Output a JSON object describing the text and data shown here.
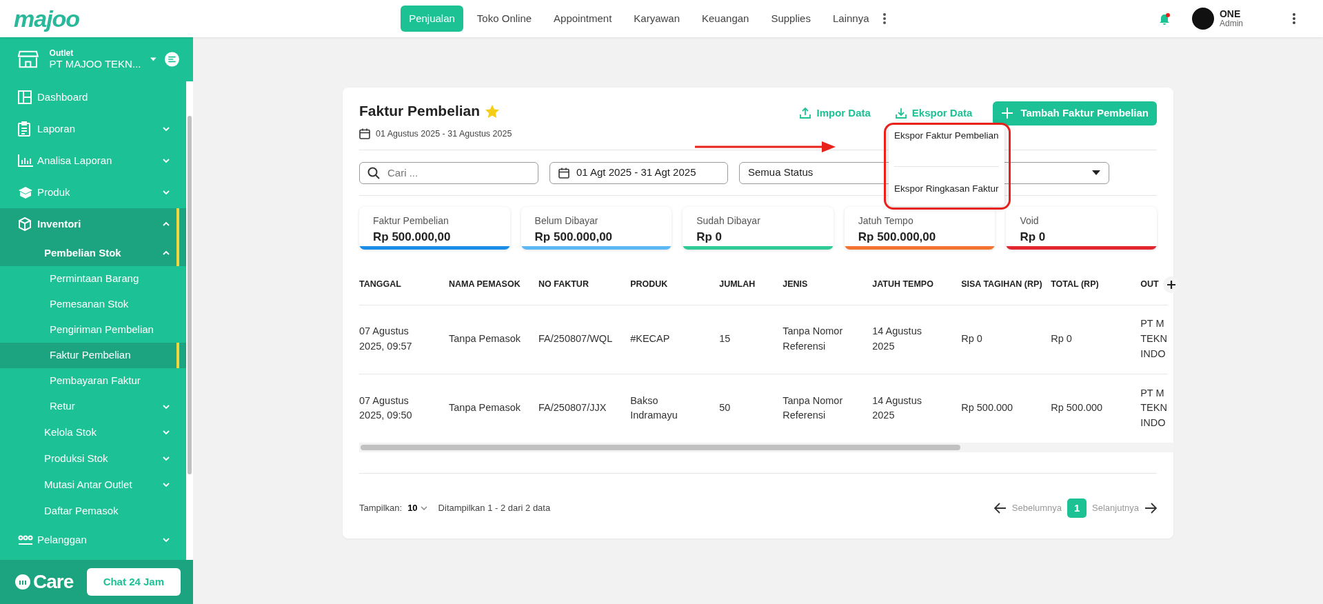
{
  "logo": "majoo",
  "top_nav": [
    {
      "label": "Penjualan",
      "selected": true
    },
    {
      "label": "Toko Online",
      "selected": false
    },
    {
      "label": "Appointment",
      "selected": false
    },
    {
      "label": "Karyawan",
      "selected": false
    },
    {
      "label": "Keuangan",
      "selected": false
    },
    {
      "label": "Supplies",
      "selected": false
    },
    {
      "label": "Lainnya",
      "selected": false
    }
  ],
  "user": {
    "name": "ONE",
    "role": "Admin",
    "notification": true
  },
  "sidebar": {
    "outlet_label": "Outlet",
    "outlet_name": "PT MAJOO TEKN...",
    "items": [
      {
        "label": "Dashboard",
        "selected": false
      },
      {
        "label": "Laporan",
        "selected": false,
        "expanded": false
      },
      {
        "label": "Analisa Laporan",
        "selected": false,
        "expanded": false
      },
      {
        "label": "Produk",
        "selected": false,
        "expanded": false
      },
      {
        "label": "Inventori",
        "selected": true,
        "expanded": true,
        "children": [
          {
            "label": "Pembelian Stok",
            "selected": true,
            "expanded": true,
            "children": [
              {
                "label": "Permintaan Barang",
                "selected": false
              },
              {
                "label": "Pemesanan Stok",
                "selected": false
              },
              {
                "label": "Pengiriman Pembelian",
                "selected": false
              },
              {
                "label": "Faktur Pembelian",
                "selected": true
              },
              {
                "label": "Pembayaran Faktur",
                "selected": false
              },
              {
                "label": "Retur",
                "selected": false,
                "expanded": false
              }
            ]
          },
          {
            "label": "Kelola Stok",
            "selected": false,
            "expanded": false
          },
          {
            "label": "Produksi Stok",
            "selected": false,
            "expanded": false
          },
          {
            "label": "Mutasi Antar Outlet",
            "selected": false,
            "expanded": false
          },
          {
            "label": "Daftar Pemasok",
            "selected": false
          }
        ]
      },
      {
        "label": "Pelanggan",
        "selected": false,
        "expanded": false
      }
    ],
    "care_logo": "Care",
    "chat_button": "Chat 24 Jam"
  },
  "page": {
    "title": "Faktur Pembelian",
    "favorite": true,
    "date_range": "01 Agustus 2025 - 31 Agustus 2025",
    "actions": {
      "import": "Impor Data",
      "export": "Ekspor Data",
      "add": "Tambah Faktur Pembelian"
    },
    "export_menu": [
      "Ekspor Faktur Pembelian",
      "Ekspor Ringkasan Faktur"
    ],
    "filters": {
      "search_placeholder": "Cari ...",
      "date": "01 Agt 2025 - 31 Agt 2025",
      "status": "Semua Status"
    },
    "summary": [
      {
        "label": "Faktur Pembelian",
        "value": "Rp 500.000,00",
        "color": "#1a8de9"
      },
      {
        "label": "Belum Dibayar",
        "value": "Rp 500.000,00",
        "color": "#5bb8f4"
      },
      {
        "label": "Sudah Dibayar",
        "value": "Rp 0",
        "color": "#2ecb99"
      },
      {
        "label": "Jatuh Tempo",
        "value": "Rp 500.000,00",
        "color": "#f57330"
      },
      {
        "label": "Void",
        "value": "Rp 0",
        "color": "#e1262f"
      }
    ],
    "table": {
      "columns": [
        "TANGGAL",
        "NAMA PEMASOK",
        "NO FAKTUR",
        "PRODUK",
        "JUMLAH",
        "JENIS",
        "JATUH TEMPO",
        "SISA TAGIHAN (RP)",
        "TOTAL (RP)",
        "OUT"
      ],
      "rows": [
        [
          "07 Agustus 2025, 09:57",
          "Tanpa Pemasok",
          "FA/250807/WQL",
          "#KECAP",
          "15",
          "Tanpa Nomor Referensi",
          "14 Agustus 2025",
          "Rp 0",
          "Rp 0",
          "PT M TEKN INDO"
        ],
        [
          "07 Agustus 2025, 09:50",
          "Tanpa Pemasok",
          "FA/250807/JJX",
          "Bakso Indramayu",
          "50",
          "Tanpa Nomor Referensi",
          "14 Agustus 2025",
          "Rp 500.000",
          "Rp 500.000",
          "PT M TEKN INDO"
        ]
      ]
    },
    "footer": {
      "show_label": "Tampilkan:",
      "page_size": "10",
      "info": "Ditampilkan 1 - 2 dari 2 data",
      "prev": "Sebelumnya",
      "next": "Selanjutnya",
      "pages": [
        {
          "label": "1",
          "selected": true
        }
      ]
    }
  }
}
